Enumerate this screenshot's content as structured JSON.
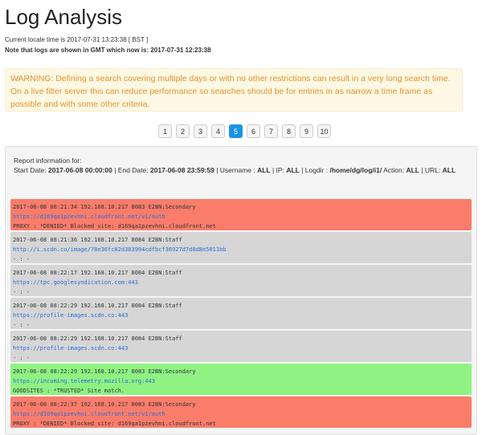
{
  "page": {
    "title": "Log Analysis",
    "locale_time": "Current locale time is 2017-07-31 13:23:38 [ BST ]",
    "gmt_note_prefix": "Note that logs are shown in GMT which now is: ",
    "gmt_time": "2017-07-31 12:23:38"
  },
  "warning": {
    "text": "WARNING: Defining a search covering multiple days or with no other restrictions can result in a very long search time. On a live filter server this can reduce performance so searches should be for entries in as narrow a time frame as possible and with some other criteria."
  },
  "pagination": {
    "pages": [
      "1",
      "2",
      "3",
      "4",
      "5",
      "6",
      "7",
      "8",
      "9",
      "10"
    ],
    "active": "5"
  },
  "report": {
    "heading": "Report information for:",
    "start_label": "Start Date: ",
    "start_value": "2017-06-08 00:00:00",
    "end_label": " | End Date: ",
    "end_value": "2017-06-08 23:59:59",
    "username_label": " | Username : ",
    "username_value": "ALL",
    "ip_label": " | IP: ",
    "ip_value": "ALL",
    "logdir_label": " | Logdir : ",
    "logdir_value": "/home/dg/log/i1/",
    "action_label": " Action: ",
    "action_value": "ALL",
    "url_label": " | URL: ",
    "url_value": "ALL"
  },
  "colors": {
    "denied": "#fa7c6b",
    "neutral": "#d6d6d6",
    "trusted": "#8ff283",
    "active_page": "#1a95e0",
    "warning_text": "#e8922e",
    "link": "#2a6cd6"
  },
  "entries": [
    {
      "status": "denied",
      "header": "2017-06-08 08:21:34 192.168.10.217 8083 E2BN:Secondary",
      "url": "https://d169qa1pzevhni.cloudfront.net/v1/auth",
      "detail": "PROXY : *DENIED* Blocked site: d169qa1pzevhni.cloudfront.net"
    },
    {
      "status": "neutral",
      "header": "2017-06-08 08:21:36 192.168.10.217 8084 E2BN:Staff",
      "url": "http://i.scdn.co/image/78e36fc82d383994cdfbcf36927d7d0d8e5011bb",
      "detail": "- : -"
    },
    {
      "status": "neutral",
      "header": "2017-06-08 08:22:17 192.168.10.217 8084 E2BN:Staff",
      "url": "https://tpc.googlesyndication.com:443",
      "detail": "- : -"
    },
    {
      "status": "neutral",
      "header": "2017-06-08 08:22:29 192.168.10.217 8084 E2BN:Staff",
      "url": "https://profile-images.scdn.co:443",
      "detail": "- : -"
    },
    {
      "status": "neutral",
      "header": "2017-06-08 08:22:29 192.168.10.217 8084 E2BN:Staff",
      "url": "https://profile-images.scdn.co:443",
      "detail": "- : -"
    },
    {
      "status": "trusted",
      "header": "2017-06-08 08:22:29 192.168.10.217 8083 E2BN:Secondary",
      "url": "https://incoming.telemetry.mozilla.org:443",
      "detail": "GOODSITES : *TRUSTED* Site match."
    },
    {
      "status": "denied",
      "header": "2017-06-08 08:22:37 192.168.10.217 8083 E2BN:Secondary",
      "url": "https://d169qa1pzevhni.cloudfront.net/v1/auth",
      "detail": "PROXY : *DENIED* Blocked site: d169qa1pzevhni.cloudfront.net"
    }
  ]
}
